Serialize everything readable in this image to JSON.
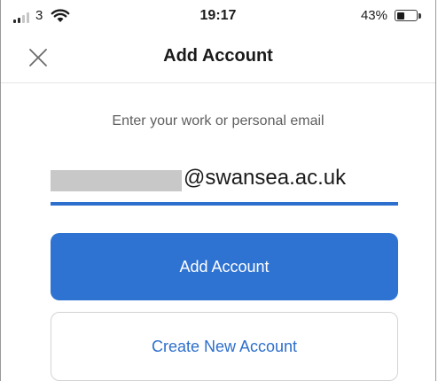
{
  "status_bar": {
    "carrier": "3",
    "time": "19:17",
    "battery_percent_text": "43%",
    "battery_level": 0.43,
    "signal_icon": "signal-strength-icon",
    "wifi_icon": "wifi-icon",
    "battery_icon": "battery-icon"
  },
  "header": {
    "title": "Add Account",
    "close_icon": "close-icon"
  },
  "main": {
    "prompt": "Enter your work or personal email",
    "email_domain": "@swansea.ac.uk",
    "add_account_label": "Add Account",
    "create_account_label": "Create New Account"
  },
  "colors": {
    "accent": "#2e72d2",
    "link": "#2d6fcc",
    "text_muted": "#5e5e5e"
  }
}
